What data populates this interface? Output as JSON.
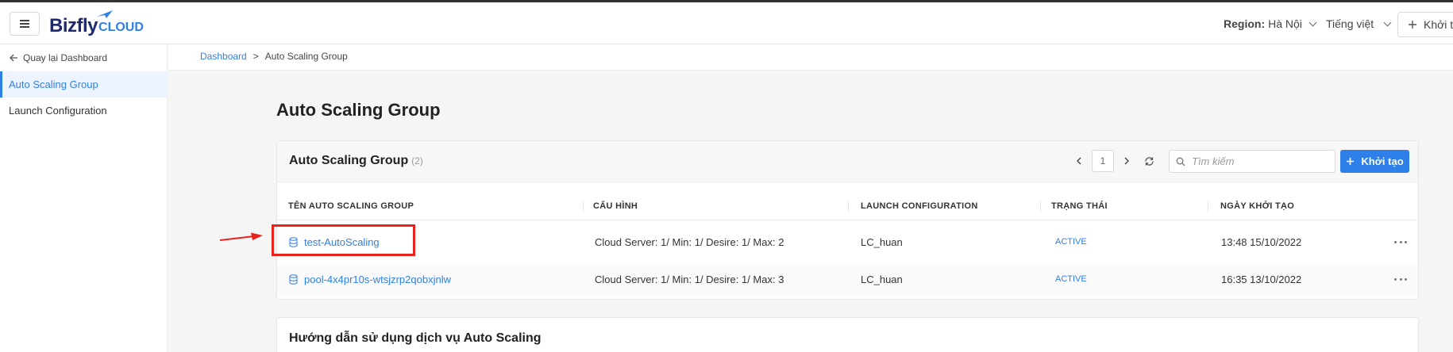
{
  "header": {
    "logo_main": "Bizfly",
    "logo_cloud": "CLOUD",
    "region_label": "Region:",
    "region_value": "Hà Nội",
    "language": "Tiếng việt",
    "create_label": "Khởi tạo"
  },
  "sidebar": {
    "back_label": "Quay lại Dashboard",
    "items": [
      {
        "label": "Auto Scaling Group",
        "active": true
      },
      {
        "label": "Launch Configuration",
        "active": false
      }
    ]
  },
  "breadcrumb": {
    "root": "Dashboard",
    "separator": ">",
    "current": "Auto Scaling Group"
  },
  "main": {
    "page_title": "Auto Scaling Group",
    "card_title": "Auto Scaling Group",
    "card_count": "(2)",
    "page_number": "1",
    "search_placeholder": "Tìm kiếm",
    "create_label": "Khởi tạo",
    "columns": [
      "TÊN AUTO SCALING GROUP",
      "CẤU HÌNH",
      "LAUNCH CONFIGURATION",
      "TRẠNG THÁI",
      "NGÀY KHỞI TẠO"
    ],
    "rows": [
      {
        "name": "test-AutoScaling",
        "config": "Cloud Server: 1/ Min: 1/ Desire: 1/ Max: 2",
        "launch_config": "LC_huan",
        "status": "ACTIVE",
        "created": "13:48 15/10/2022"
      },
      {
        "name": "pool-4x4pr10s-wtsjzrp2qobxjnlw",
        "config": "Cloud Server: 1/ Min: 1/ Desire: 1/ Max: 3",
        "launch_config": "LC_huan",
        "status": "ACTIVE",
        "created": "16:35 13/10/2022"
      }
    ],
    "guide_title": "Hướng dẫn sử dụng dịch vụ Auto Scaling"
  },
  "colors": {
    "accent": "#2f7fe8",
    "highlight": "#e8231e",
    "brand_dark": "#1e2a6b"
  },
  "icons": [
    "menu-icon",
    "logo-mark-icon",
    "chevron-down-icon",
    "plus-icon",
    "arrow-left-icon",
    "chevron-left-icon",
    "chevron-right-icon",
    "refresh-icon",
    "search-icon",
    "database-icon",
    "more-icon"
  ]
}
